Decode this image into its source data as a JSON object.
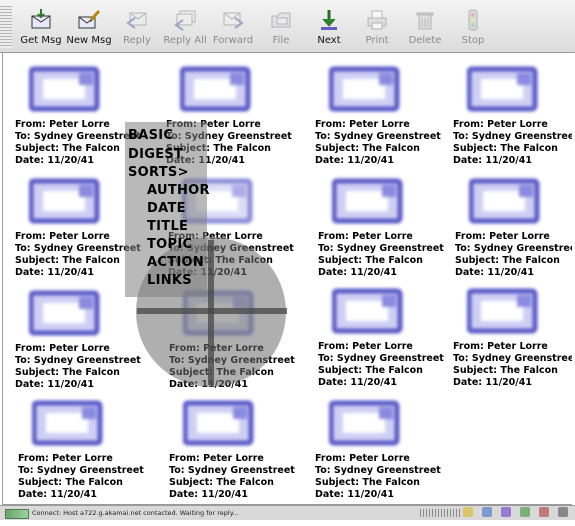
{
  "toolbar": {
    "buttons": [
      {
        "key": "get-msg",
        "label": "Get Msg",
        "icon": "get-mail-icon",
        "enabled": true
      },
      {
        "key": "new-msg",
        "label": "New Msg",
        "icon": "compose-icon",
        "enabled": true
      },
      {
        "key": "reply",
        "label": "Reply",
        "icon": "reply-icon",
        "enabled": false
      },
      {
        "key": "reply-all",
        "label": "Reply All",
        "icon": "reply-all-icon",
        "enabled": false
      },
      {
        "key": "forward",
        "label": "Forward",
        "icon": "forward-icon",
        "enabled": false
      },
      {
        "key": "file",
        "label": "File",
        "icon": "folder-icon",
        "enabled": false
      },
      {
        "key": "next",
        "label": "Next",
        "icon": "next-arrow-icon",
        "enabled": true
      },
      {
        "key": "print",
        "label": "Print",
        "icon": "printer-icon",
        "enabled": false
      },
      {
        "key": "delete",
        "label": "Delete",
        "icon": "trash-icon",
        "enabled": false
      },
      {
        "key": "stop",
        "label": "Stop",
        "icon": "stop-light-icon",
        "enabled": false
      }
    ]
  },
  "messages": [
    {
      "from": "From:  Peter Lorre",
      "to": "To:  Sydney Greenstreet",
      "subject": "Subject:  The Falcon",
      "date": "Date:  11/20/41"
    },
    {
      "from": "From:  Peter Lorre",
      "to": "To:  Sydney Greenstreet",
      "subject": "Subject:  The Falcon",
      "date": "Date:  11/20/41"
    },
    {
      "from": "From:  Peter Lorre",
      "to": "To:  Sydney Greenstreet",
      "subject": "Subject:  The Falcon",
      "date": "Date:  11/20/41"
    },
    {
      "from": "From:  Peter Lorre",
      "to": "To:  Sydney Greenstreet",
      "subject": "Subject:  The Falcon",
      "date": "Date:  11/20/41"
    },
    {
      "from": "From:  Peter Lorre",
      "to": "To:  Sydney Greenstreet",
      "subject": "Subject:  The Falcon",
      "date": "Date:  11/20/41"
    },
    {
      "from": "From:  Peter Lorre",
      "to": "To:  Sydney Greenstreet",
      "subject": "Subject:  The Falcon",
      "date": "Date:  11/20/41"
    },
    {
      "from": "From:  Peter Lorre",
      "to": "To:  Sydney Greenstreet",
      "subject": "Subject:  The Falcon",
      "date": "Date:  11/20/41"
    },
    {
      "from": "From:  Peter Lorre",
      "to": "To:  Sydney Greenstreet",
      "subject": "Subject:  The Falcon",
      "date": "Date:  11/20/41"
    },
    {
      "from": "From:  Peter Lorre",
      "to": "To:  Sydney Greenstreet",
      "subject": "Subject:  The Falcon",
      "date": "Date:  11/20/41"
    },
    {
      "from": "From:  Peter Lorre",
      "to": "To:  Sydney Greenstreet",
      "subject": "Subject:  The Falcon",
      "date": "Date:  11/20/41"
    },
    {
      "from": "From:  Peter Lorre",
      "to": "To:  Sydney Greenstreet",
      "subject": "Subject:  The Falcon",
      "date": "Date:  11/20/41"
    },
    {
      "from": "From:  Peter Lorre",
      "to": "To:  Sydney Greenstreet",
      "subject": "Subject:  The Falcon",
      "date": "Date:  11/20/41"
    },
    {
      "from": "From:  Peter Lorre",
      "to": "To:  Sydney Greenstreet",
      "subject": "Subject:  The Falcon",
      "date": "Date:  11/20/41"
    },
    {
      "from": "From:  Peter Lorre",
      "to": "To:  Sydney Greenstreet",
      "subject": "Subject:  The Falcon",
      "date": "Date:  11/20/41"
    },
    {
      "from": "From:  Peter Lorre",
      "to": "To:  Sydney Greenstreet",
      "subject": "Subject:  The Falcon",
      "date": "Date:  11/20/41"
    }
  ],
  "overlay_menu": {
    "items": [
      "BASIC",
      "DIGEST",
      "SORTS>",
      "AUTHOR",
      "DATE",
      "TITLE",
      "TOPIC",
      "ACTION",
      "LINKS"
    ]
  },
  "statusbar": {
    "text": "Connect: Host a722.g.akamai.net contacted. Waiting for reply..."
  },
  "colors": {
    "envelope": "#5a5ac8",
    "envelope_light": "#c8c8f0",
    "overlay_gray": "#808080"
  }
}
